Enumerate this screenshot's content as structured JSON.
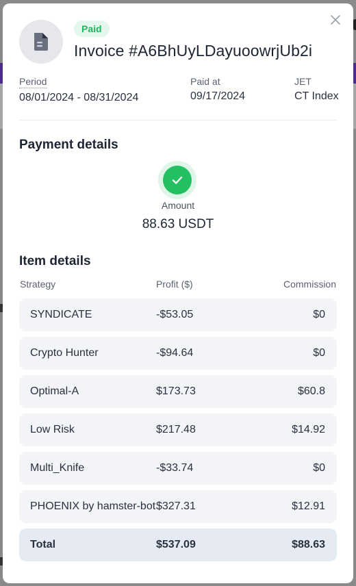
{
  "invoice": {
    "status": "Paid",
    "title": "Invoice #A6BhUyLDayuoowrjUb2i",
    "period_label": "Period",
    "period_value": "08/01/2024 - 08/31/2024",
    "paid_at_label": "Paid at",
    "paid_at_value": "09/17/2024",
    "jet_label": "JET",
    "jet_value": "CT Index"
  },
  "payment": {
    "title": "Payment details",
    "amount_label": "Amount",
    "amount_value": "88.63 USDT"
  },
  "items": {
    "title": "Item details",
    "columns": [
      "Strategy",
      "Profit ($)",
      "Commission"
    ],
    "rows": [
      {
        "strategy": "SYNDICATE",
        "profit": "-$53.05",
        "commission": "$0"
      },
      {
        "strategy": "Crypto Hunter",
        "profit": "-$94.64",
        "commission": "$0"
      },
      {
        "strategy": "Optimal-A",
        "profit": "$173.73",
        "commission": "$60.8"
      },
      {
        "strategy": "Low Risk",
        "profit": "$217.48",
        "commission": "$14.92"
      },
      {
        "strategy": "Multi_Knife",
        "profit": "-$33.74",
        "commission": "$0"
      },
      {
        "strategy": "PHOENIX by hamster-bot",
        "profit": "$327.31",
        "commission": "$12.91"
      }
    ],
    "total": {
      "label": "Total",
      "profit": "$537.09",
      "commission": "$88.63"
    }
  },
  "colors": {
    "paid_badge_bg": "#e4f7ec",
    "paid_badge_text": "#1fb55e",
    "success_green": "#22c060",
    "row_bg": "#f3f4f7",
    "total_row_bg": "#e6ebf3"
  },
  "icons": {
    "close": "close-icon",
    "document": "document-icon",
    "check": "check-icon"
  }
}
